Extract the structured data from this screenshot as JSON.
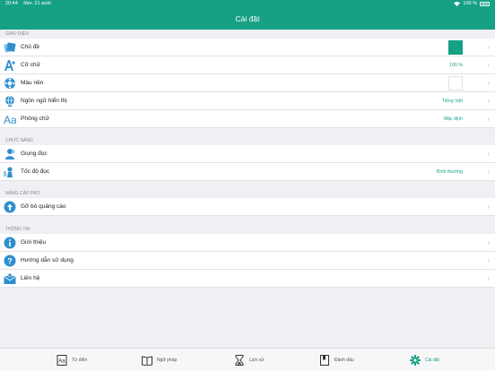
{
  "status_bar": {
    "time": "20:44",
    "date": "Mer. 21 août",
    "battery": "100 %"
  },
  "nav": {
    "title": "Cài đặt"
  },
  "sections": {
    "giao_dien": {
      "header": "GIAO DIỆN",
      "rows": [
        {
          "label": "Chủ đề",
          "icon": "theme-icon",
          "swatch": "#16a085"
        },
        {
          "label": "Cỡ chữ",
          "icon": "font-size-icon",
          "value": "100 %"
        },
        {
          "label": "Màu nền",
          "icon": "background-color-icon",
          "swatch": "#ffffff"
        },
        {
          "label": "Ngôn ngữ hiển thị",
          "icon": "globe-icon",
          "value": "Tiếng Việt"
        },
        {
          "label": "Phông chữ",
          "icon": "font-icon",
          "value": "Mặc định"
        }
      ]
    },
    "chuc_nang": {
      "header": "CHỨC NĂNG",
      "rows": [
        {
          "label": "Giọng đọc",
          "icon": "voice-icon"
        },
        {
          "label": "Tốc độ đọc",
          "icon": "speed-icon",
          "value": "Bình thường"
        }
      ]
    },
    "nang_cap": {
      "header": "NÂNG CẤP PRO",
      "rows": [
        {
          "label": "Gỡ bỏ quảng cáo",
          "icon": "upgrade-arrow-icon"
        }
      ]
    },
    "thong_tin": {
      "header": "THÔNG TIN",
      "rows": [
        {
          "label": "Giới thiệu",
          "icon": "info-icon"
        },
        {
          "label": "Hướng dẫn sử dụng",
          "icon": "help-icon"
        },
        {
          "label": "Liên hệ",
          "icon": "contact-icon"
        }
      ]
    }
  },
  "tabbar": {
    "items": [
      {
        "label": "Từ điển",
        "icon": "dictionary-icon"
      },
      {
        "label": "Ngữ pháp",
        "icon": "book-icon"
      },
      {
        "label": "Lịch sử",
        "icon": "hourglass-icon"
      },
      {
        "label": "Đánh dấu",
        "icon": "bookmark-icon"
      },
      {
        "label": "Cài đặt",
        "icon": "gear-icon",
        "active": true
      }
    ]
  },
  "colors": {
    "accent": "#16a085",
    "background": "#efeff4",
    "separator": "#e2e2e6"
  }
}
